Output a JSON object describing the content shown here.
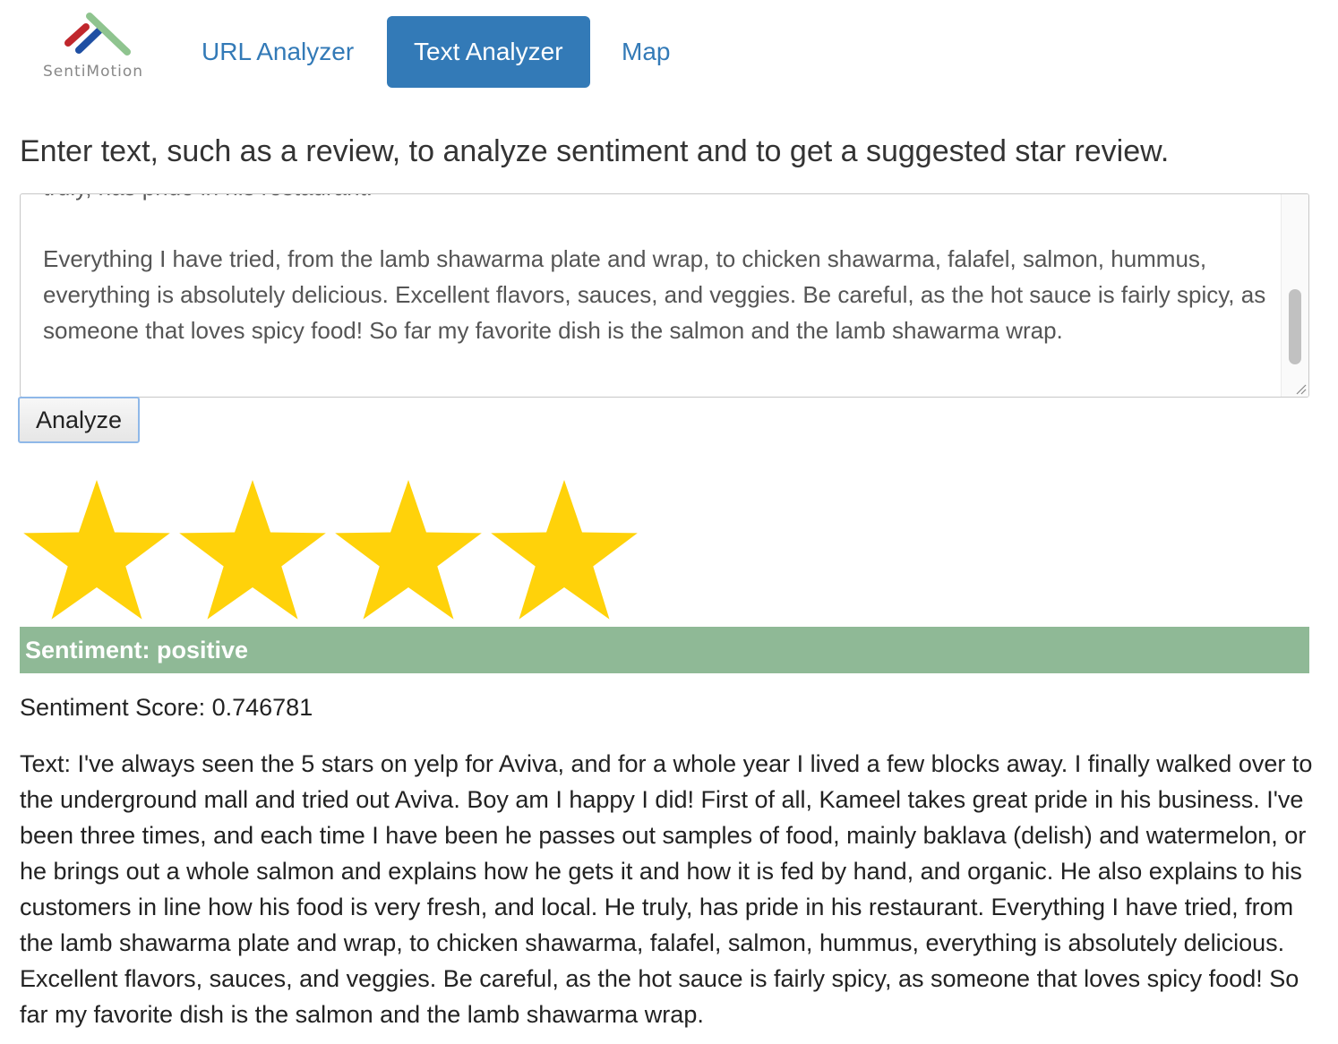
{
  "brand": {
    "name": "SentiMotion",
    "colors": [
      "#c0272d",
      "#1f4fa3",
      "#8fc48f"
    ]
  },
  "nav": {
    "items": [
      {
        "label": "URL Analyzer",
        "active": false
      },
      {
        "label": "Text Analyzer",
        "active": true
      },
      {
        "label": "Map",
        "active": false
      }
    ]
  },
  "instructions": "Enter text, such as a review, to analyze sentiment and to get a suggested star review.",
  "textarea": {
    "value": "truly, has pride in his restaurant.\n\nEverything I have tried, from the lamb shawarma plate and wrap, to chicken shawarma, falafel, salmon, hummus, everything is absolutely delicious. Excellent flavors, sauces, and veggies. Be careful, as the hot sauce is fairly spicy, as someone that loves spicy food! So far my favorite dish is the salmon and the lamb shawarma wrap."
  },
  "analyze_button": "Analyze",
  "result": {
    "stars": 4,
    "star_color": "#ffd20a",
    "sentiment_label": "Sentiment: positive",
    "sentiment_color": "#8fb996",
    "score_text": "Sentiment Score: 0.746781",
    "text": "Text: I've always seen the 5 stars on yelp for Aviva, and for a whole year I lived a few blocks away. I finally walked over to the underground mall and tried out Aviva. Boy am I happy I did! First of all, Kameel takes great pride in his business. I've been three times, and each time I have been he passes out samples of food, mainly baklava (delish) and watermelon, or he brings out a whole salmon and explains how he gets it and how it is fed by hand, and organic. He also explains to his customers in line how his food is very fresh, and local. He truly, has pride in his restaurant. Everything I have tried, from the lamb shawarma plate and wrap, to chicken shawarma, falafel, salmon, hummus, everything is absolutely delicious. Excellent flavors, sauces, and veggies. Be careful, as the hot sauce is fairly spicy, as someone that loves spicy food! So far my favorite dish is the salmon and the lamb shawarma wrap."
  }
}
